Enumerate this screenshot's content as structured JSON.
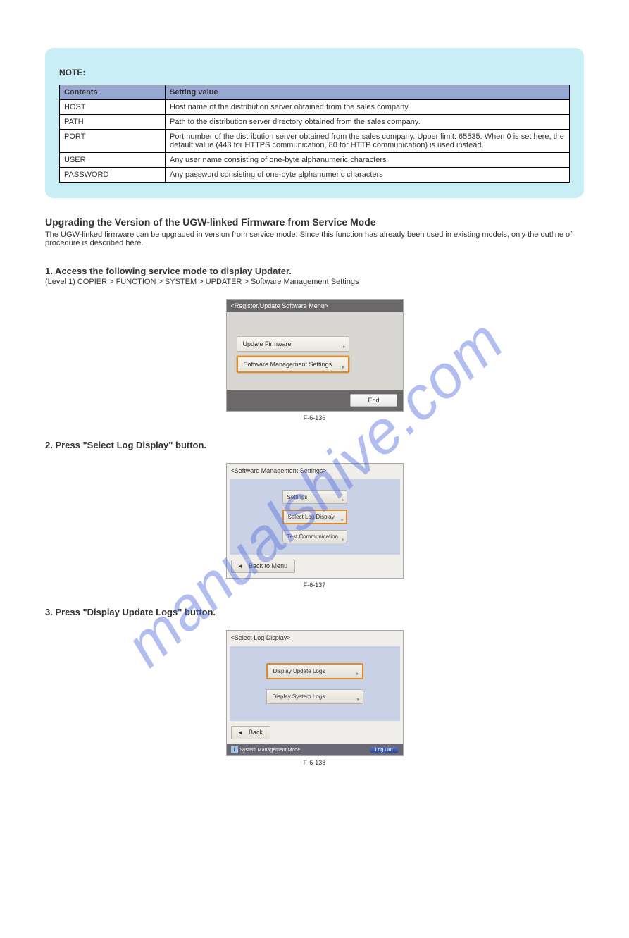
{
  "note": {
    "title": "NOTE:",
    "table": {
      "head": [
        "Contents",
        "Setting value"
      ],
      "rows": [
        [
          "HOST",
          "Host name of the distribution server obtained from the sales company."
        ],
        [
          "PATH",
          "Path to the distribution server directory obtained from the sales company."
        ],
        [
          "PORT",
          "Port number of the distribution server obtained from the sales company. Upper limit: 65535. When 0 is set here, the default value (443 for HTTPS communication, 80 for HTTP communication) is used instead."
        ],
        [
          "USER",
          "Any user name consisting of one-byte alphanumeric characters"
        ],
        [
          "PASSWORD",
          "Any password consisting of one-byte alphanumeric characters"
        ]
      ]
    }
  },
  "sections": {
    "main_title": "Upgrading the Version of the UGW-linked Firmware from Service Mode",
    "main_body": "The UGW-linked firmware can be upgraded in version from service mode. Since this function has already been used in existing models, only the outline of procedure is described here.",
    "step1_title": "1. Access the following service mode to display Updater.",
    "step1_body": "(Level 1) COPIER > FUNCTION > SYSTEM > UPDATER > Software Management Settings",
    "step2_title": "2. Press \"Select Log Display\" button.",
    "step3_title": "3. Press \"Display Update Logs\" button."
  },
  "figures": {
    "f1": {
      "header": "<Register/Update Software Menu>",
      "btn1": "Update Firmware",
      "btn2": "Software Management Settings",
      "end": "End",
      "caption": "F-6-136"
    },
    "f2": {
      "header": "<Software Management Settings>",
      "btn1": "Settings",
      "btn2": "Select Log Display",
      "btn3": "Test Communication",
      "back": "Back to Menu",
      "caption": "F-6-137"
    },
    "f3": {
      "header": "<Select Log Display>",
      "btn1": "Display Update Logs",
      "btn2": "Display System Logs",
      "back": "Back",
      "status": "System Management Mode",
      "logout": "Log Out",
      "caption": "F-6-138"
    },
    "arrow_glyph": "▸",
    "back_glyph": "◂"
  }
}
